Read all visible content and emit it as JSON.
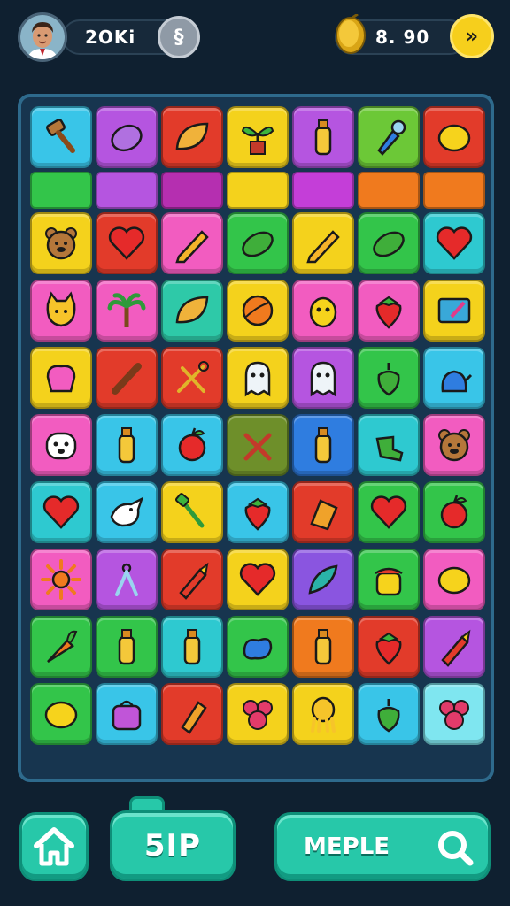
{
  "header": {
    "score": "2OKi",
    "grey_badge_icon": "§",
    "coins": "8. 90",
    "yellow_badge_icon": "»"
  },
  "board": {
    "rows": [
      [
        "#39c5e8",
        "#b555e0",
        "#e23b2a",
        "#f4d21c",
        "#b555e0",
        "#6cc837",
        "#e23b2a"
      ],
      [
        "strip",
        "strip",
        "strip",
        "strip",
        "strip",
        "strip",
        "strip"
      ],
      [
        "#f4d21c",
        "#e23b2a",
        "#f25cc0",
        "#33c54a",
        "#f4d21c",
        "#33c54a",
        "#2ec9d0"
      ],
      [
        "#f25cc0",
        "#f25cc0",
        "#2ec9a8",
        "#f4d21c",
        "#f25cc0",
        "#f25cc0",
        "#f4d21c"
      ],
      [
        "#f4d21c",
        "#e23b2a",
        "#e23b2a",
        "#f4d21c",
        "#b555e0",
        "#33c54a",
        "#39c5e8"
      ],
      [
        "#f25cc0",
        "#39c5e8",
        "#39c5e8",
        "#6e8f2a",
        "#2f7de0",
        "#2ec9d0",
        "#f25cc0"
      ],
      [
        "#2ec9d0",
        "#39c5e8",
        "#f4d21c",
        "#39c5e8",
        "#e23b2a",
        "#33c54a",
        "#33c54a"
      ],
      [
        "#f25cc0",
        "#b555e0",
        "#e23b2a",
        "#f4d21c",
        "#8a55e0",
        "#33c54a",
        "#f25cc0"
      ],
      [
        "#33c54a",
        "#33c54a",
        "#2ec9d0",
        "#33c54a",
        "#f07a1e",
        "#e23b2a",
        "#b555e0"
      ],
      [
        "#33c54a",
        "#39c5e8",
        "#e23b2a",
        "#f4d21c",
        "#f4d21c",
        "#39c5e8",
        "#7fe6f0"
      ]
    ],
    "strip_colors": [
      "#33c54a",
      "#b555e0",
      "#b52fb0",
      "#f4d21c",
      "#c43ed8",
      "#f07a1e",
      "#f07a1e"
    ],
    "icons": [
      [
        "hammer-icon",
        "eggplant-icon",
        "leaf-icon",
        "plant-icon",
        "bottle-icon",
        "flashlight-icon",
        "lemon-icon"
      ],
      [],
      [
        "bear-icon",
        "heart-icon",
        "pencil-icon",
        "pickle-icon",
        "pencil-icon",
        "pickle-icon",
        "heart-icon"
      ],
      [
        "cat-icon",
        "palm-icon",
        "leaf-icon",
        "ball-icon",
        "face-icon",
        "strawberry-icon",
        "tablet-icon"
      ],
      [
        "hat-icon",
        "stick-icon",
        "tools-icon",
        "ghost-icon",
        "ghost-icon",
        "pepper-icon",
        "kettle-icon"
      ],
      [
        "dog-icon",
        "bottle-icon",
        "apple-icon",
        "scissors-icon",
        "bottle-icon",
        "sock-icon",
        "bear-icon"
      ],
      [
        "heart-icon",
        "bird-icon",
        "brush-icon",
        "strawberry-icon",
        "box-icon",
        "heart-icon",
        "apple-icon"
      ],
      [
        "sun-icon",
        "compass-icon",
        "crayon-icon",
        "heart-icon",
        "feather-icon",
        "pot-icon",
        "lemon-icon"
      ],
      [
        "carrot-icon",
        "bottle-icon",
        "bottle-icon",
        "bean-icon",
        "bottle-icon",
        "strawberry-icon",
        "crayon-icon"
      ],
      [
        "lemon-icon",
        "bag-icon",
        "popsicle-icon",
        "flower-icon",
        "octopus-icon",
        "pepper-icon",
        "flower-icon"
      ]
    ]
  },
  "footer": {
    "mid_label": "5IP",
    "right_label": "MEPLE"
  }
}
